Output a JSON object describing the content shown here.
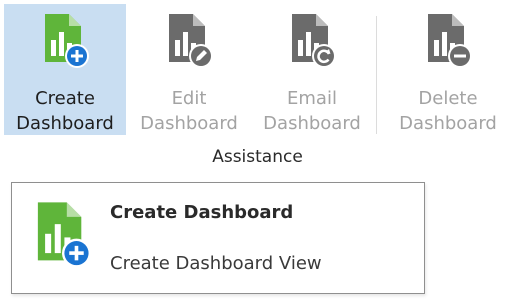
{
  "ribbon": {
    "buttons": [
      {
        "line1": "Create",
        "line2": "Dashboard",
        "state": "active",
        "icon": "create-dashboard-icon"
      },
      {
        "line1": "Edit",
        "line2": "Dashboard",
        "state": "disabled",
        "icon": "edit-dashboard-icon"
      },
      {
        "line1": "Email",
        "line2": "Dashboard",
        "state": "disabled",
        "icon": "email-dashboard-icon"
      },
      {
        "line1": "Delete",
        "line2": "Dashboard",
        "state": "disabled",
        "icon": "delete-dashboard-icon"
      }
    ],
    "group_label": "Assistance"
  },
  "dropdown": {
    "items": [
      {
        "label": "Create Dashboard"
      },
      {
        "label": "Create Dashboard View"
      }
    ],
    "icon": "create-dashboard-icon"
  },
  "colors": {
    "active_bg": "#c9def2",
    "icon_green": "#5fb53a",
    "icon_gray": "#6b6b6b",
    "badge_blue": "#1a74d2",
    "disabled_text": "#a3a3a3"
  }
}
